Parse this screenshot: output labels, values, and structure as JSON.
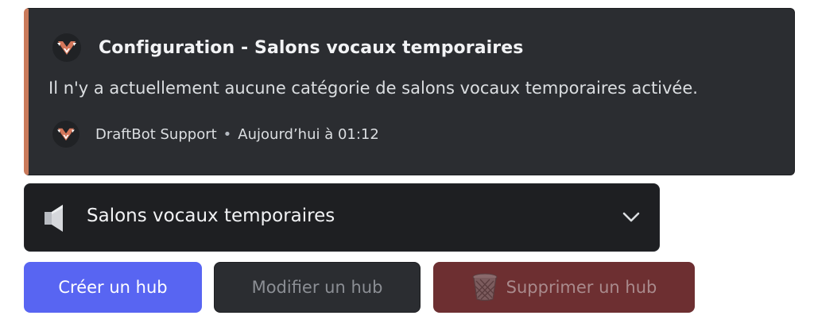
{
  "embed": {
    "accent_color": "#c97a5b",
    "icon": "draftbot-logo-icon",
    "title": "Configuration - Salons vocaux temporaires",
    "description": "Il n'y a actuellement aucune catégorie de salons vocaux temporaires activée.",
    "footer": {
      "icon": "draftbot-logo-icon",
      "author": "DraftBot Support",
      "separator": "•",
      "timestamp": "Aujourd’hui à 01:12"
    }
  },
  "select": {
    "icon": "speaker-icon",
    "label": "Salons vocaux temporaires",
    "chevron_icon": "chevron-down-icon"
  },
  "buttons": {
    "create": {
      "label": "Créer un hub",
      "color": "#5865f2",
      "enabled": true
    },
    "edit": {
      "label": "Modifier un hub",
      "color": "#2b2d31",
      "enabled": false
    },
    "delete": {
      "label": "Supprimer un hub",
      "icon": "wastebasket-icon",
      "color": "#6d2f31",
      "enabled": false
    }
  }
}
